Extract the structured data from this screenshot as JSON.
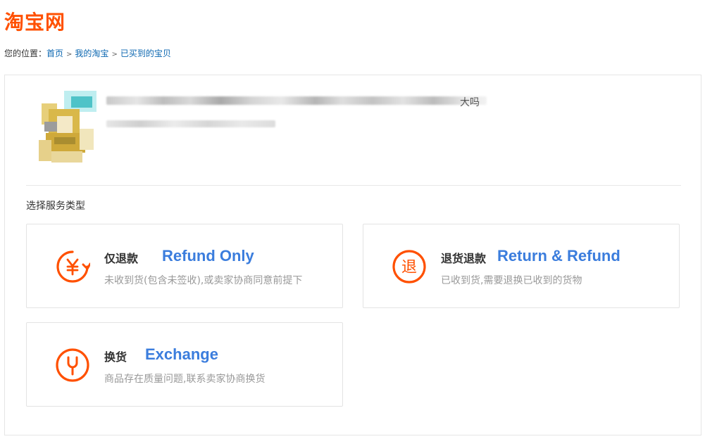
{
  "logo": {
    "text": "淘宝网",
    "color": "#ff5000"
  },
  "breadcrumb": {
    "label": "您的位置：",
    "items": [
      "首页",
      "我的淘宝",
      "已买到的宝贝"
    ],
    "separator": ">"
  },
  "product": {
    "title_tail": "大吗"
  },
  "section_label": "选择服务类型",
  "options": [
    {
      "icon": "yen-refund-icon",
      "title": "仅退款",
      "english": "Refund Only",
      "description": "未收到货(包含未签收),或卖家协商同意前提下"
    },
    {
      "icon": "return-circle-icon",
      "icon_char": "退",
      "title": "退货退款",
      "english": "Return & Refund",
      "description": "已收到货,需要退换已收到的货物"
    },
    {
      "icon": "wrench-exchange-icon",
      "title": "换货",
      "english": "Exchange",
      "description": "商品存在质量问题,联系卖家协商换货"
    }
  ],
  "colors": {
    "accent": "#ff5000",
    "annotation": "#3b7ddd",
    "link": "#0a66b0"
  }
}
